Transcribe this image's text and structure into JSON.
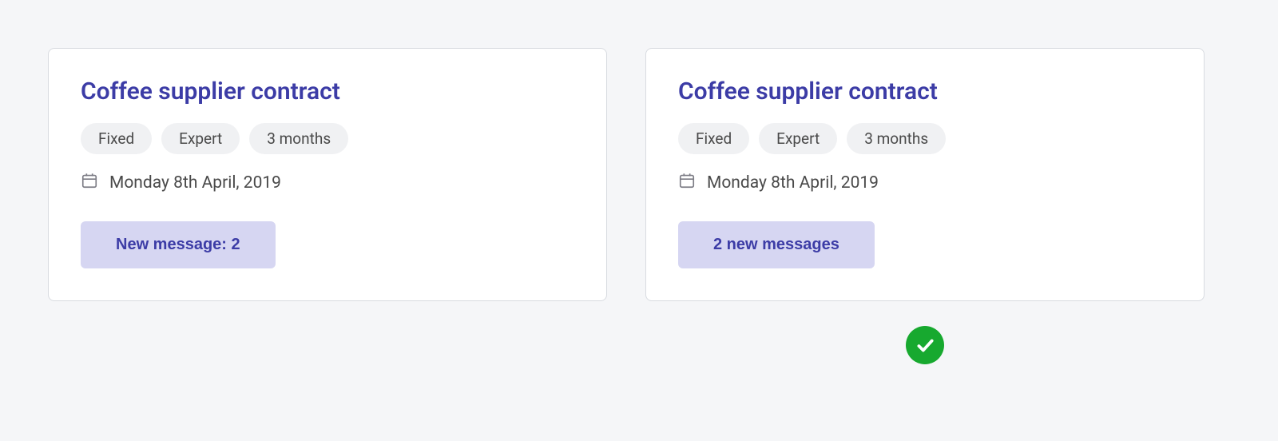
{
  "colors": {
    "accent": "#3c3ca6",
    "tag_bg": "#f0f1f3",
    "msg_bg": "#d6d6f2",
    "success": "#17a92f"
  },
  "cards": [
    {
      "title": "Coffee supplier contract",
      "tags": [
        "Fixed",
        "Expert",
        "3 months"
      ],
      "date": "Monday 8th April, 2019",
      "message_label": "New message: 2",
      "approved": false
    },
    {
      "title": "Coffee supplier contract",
      "tags": [
        "Fixed",
        "Expert",
        "3 months"
      ],
      "date": "Monday 8th April, 2019",
      "message_label": "2 new messages",
      "approved": true
    }
  ]
}
